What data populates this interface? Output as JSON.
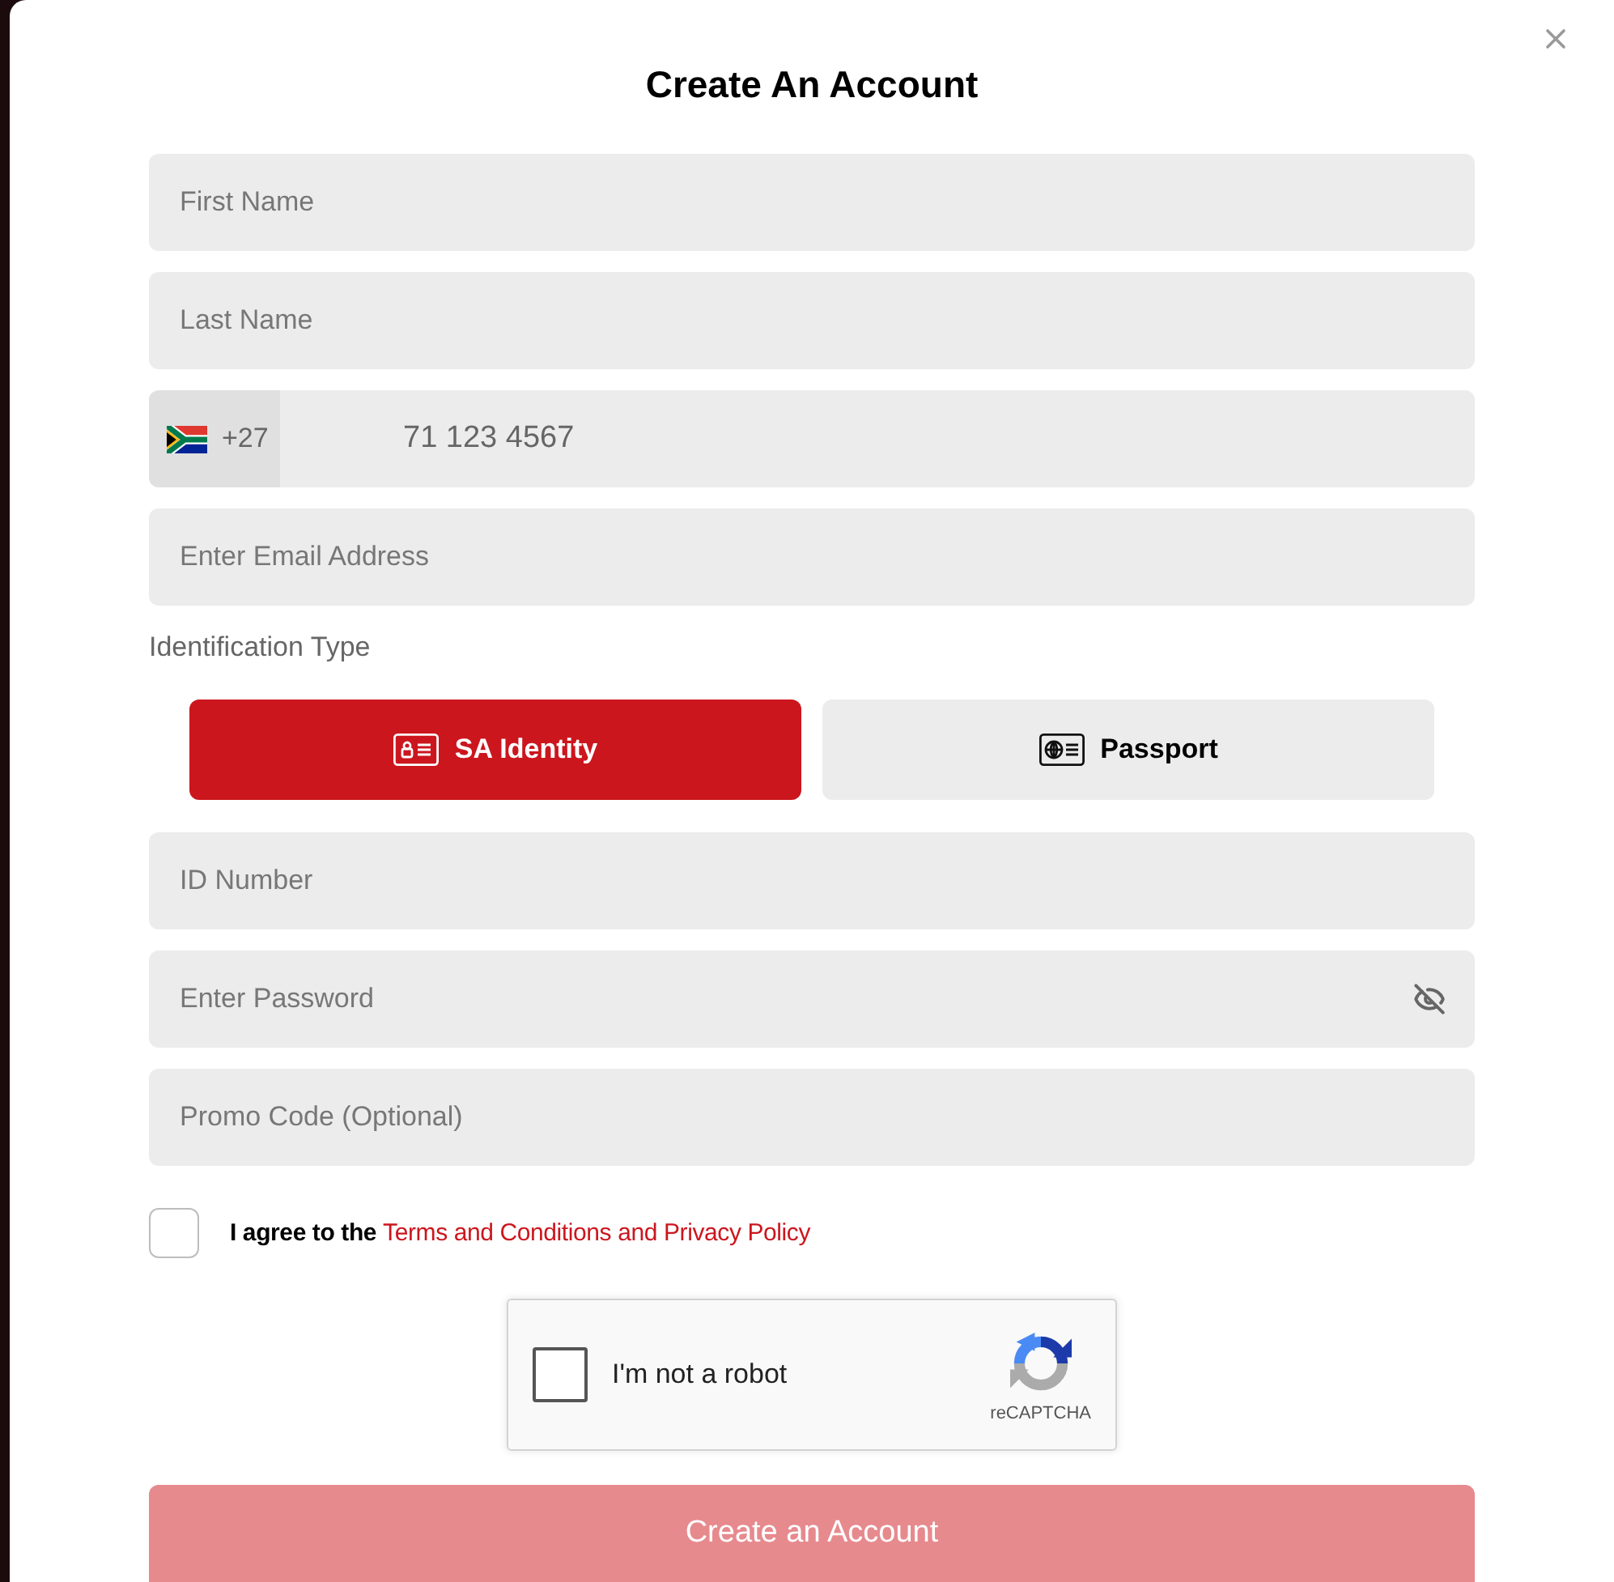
{
  "dialog": {
    "title": "Create An Account"
  },
  "contact_fields": [
    {
      "kind": "text",
      "placeholder": "First Name"
    },
    {
      "kind": "text",
      "placeholder": "Last Name"
    },
    {
      "kind": "phone",
      "country_code": "+27",
      "placeholder": "71 123 4567"
    },
    {
      "kind": "text",
      "placeholder": "Enter Email Address"
    }
  ],
  "identification": {
    "label": "Identification Type",
    "options": [
      {
        "kind": "id-card",
        "label": "SA Identity",
        "selected": true
      },
      {
        "kind": "passport",
        "label": "Passport",
        "selected": false
      }
    ]
  },
  "account_fields": [
    {
      "kind": "text",
      "placeholder": "ID Number"
    },
    {
      "kind": "password",
      "placeholder": "Enter Password"
    },
    {
      "kind": "text",
      "placeholder": "Promo Code (Optional)"
    }
  ],
  "terms": {
    "checked": false,
    "text": "I agree to the",
    "link": "Terms and Conditions and Privacy Policy"
  },
  "captcha": {
    "checked": false,
    "label": "I'm not a robot",
    "brand": "reCAPTCHA"
  },
  "submit": {
    "label": "Create an Account",
    "disabled": true
  }
}
